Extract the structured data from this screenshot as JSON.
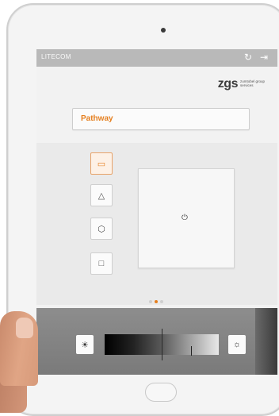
{
  "app": {
    "name": "LITECOM",
    "icons": {
      "refresh": "refresh-icon",
      "logout": "logout-icon"
    }
  },
  "brand": {
    "mark": "zgs",
    "text_line1": "zumtobel group",
    "text_line2": "services"
  },
  "zone": {
    "name": "Pathway"
  },
  "scene_buttons": [
    {
      "icon": "lamp-icon",
      "active": true
    },
    {
      "icon": "pendant-light-icon",
      "active": false
    },
    {
      "icon": "ceiling-light-icon",
      "active": false
    },
    {
      "icon": "door-icon",
      "active": false
    }
  ],
  "power": {
    "icon": "power-icon"
  },
  "pager": {
    "pages": 3,
    "current": 2
  },
  "dimmer": {
    "min_icon": "sun-dark-icon",
    "max_icon": "sun-light-icon"
  },
  "colors": {
    "accent": "#e57f1f"
  }
}
